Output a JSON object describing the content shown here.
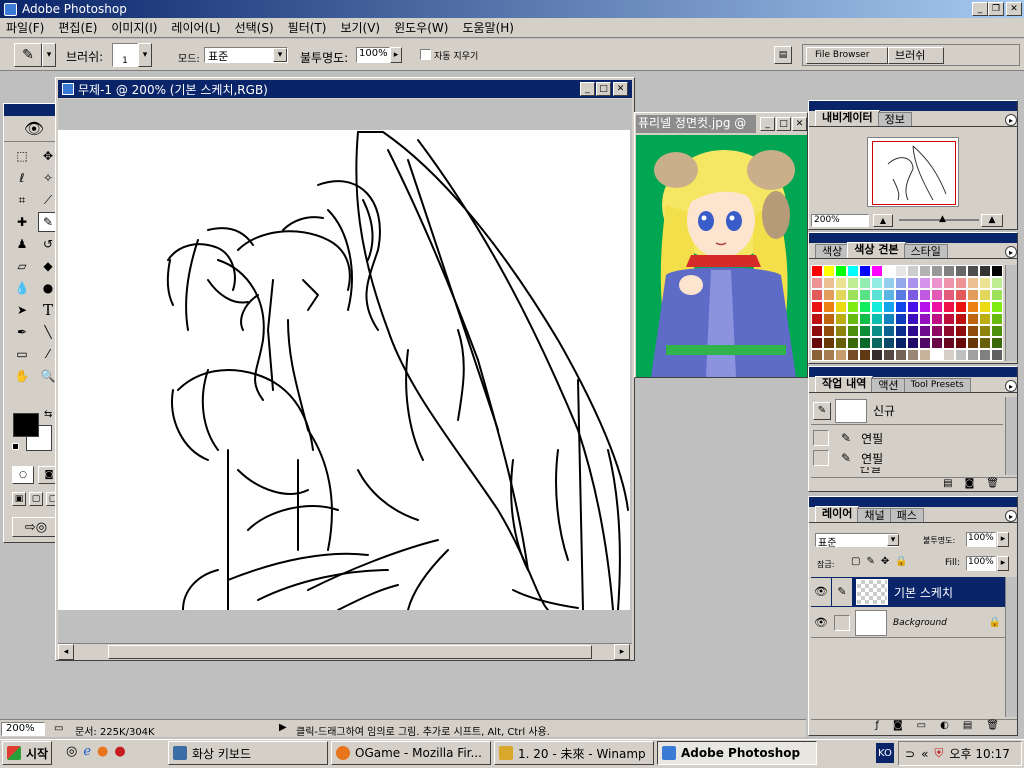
{
  "app": {
    "title": "Adobe Photoshop"
  },
  "menu": [
    "파일(F)",
    "편집(E)",
    "이미지(I)",
    "레이어(L)",
    "선택(S)",
    "필터(T)",
    "보기(V)",
    "윈도우(W)",
    "도움말(H)"
  ],
  "options": {
    "brush_label": "브러쉬:",
    "brush_size": "1",
    "mode_label": "모드:",
    "mode_value": "표준",
    "opacity_label": "불투명도:",
    "opacity_value": "100%",
    "auto_erase": "자동 지우기",
    "file_browser": "File Browser",
    "brushes_tab": "브러쉬"
  },
  "document": {
    "title": "무제-1 @ 200% (기본 스케치,RGB)"
  },
  "reference": {
    "title": "퓨리넬 정면컷.jpg @"
  },
  "navigator": {
    "tabs": [
      "내비게이터",
      "정보"
    ],
    "zoom": "200%"
  },
  "swatches": {
    "tabs": [
      "색상",
      "색상 견본",
      "스타일"
    ]
  },
  "history": {
    "tabs": [
      "작업 내역",
      "액션",
      "Tool Presets"
    ],
    "snapshot": "신규",
    "items": [
      "연필",
      "연필",
      "연필"
    ]
  },
  "layers": {
    "tabs": [
      "레이어",
      "채널",
      "패스"
    ],
    "blend": "표준",
    "opacity_label": "불투명도:",
    "opacity": "100%",
    "lock_label": "잠금:",
    "fill_label": "Fill:",
    "fill": "100%",
    "items": [
      "기본 스케치",
      "Background"
    ]
  },
  "status": {
    "zoom": "200%",
    "doc": "문서: 225K/304K",
    "hint": "클릭-드래그하여 임의로 그림. 추가로 시프트, Alt, Ctrl 사용."
  },
  "taskbar": {
    "start": "시작",
    "tasks": [
      "화상 키보드",
      "OGame - Mozilla Fir...",
      "1. 20 - 未來 - Winamp",
      "Adobe Photoshop"
    ],
    "lang": "KO",
    "clock": "오후 10:17"
  },
  "colors": {
    "titlebar": "#0a246a",
    "chrome": "#d4d0c8",
    "workspace": "#bfbfbf",
    "swatch_green": "#00a651"
  }
}
